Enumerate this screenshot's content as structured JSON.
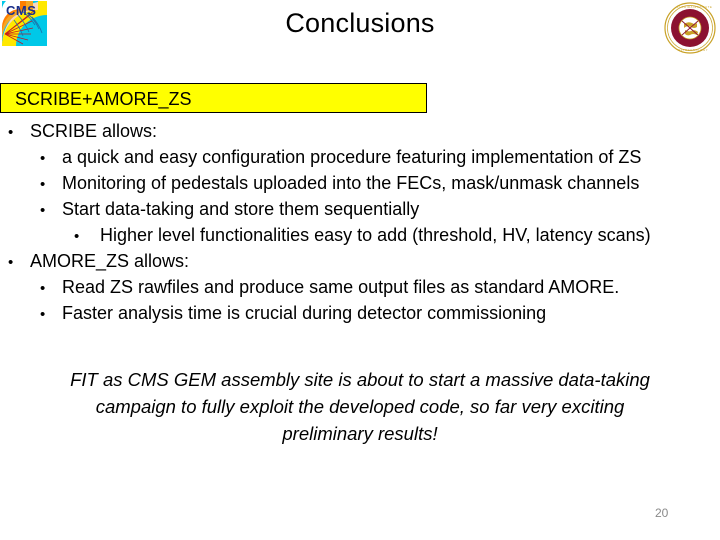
{
  "slide": {
    "title": "Conclusions",
    "page_number": "20"
  },
  "logos": {
    "left": {
      "name": "cms-experiment-logo",
      "colors": {
        "blue": "#19a9dd",
        "cyan": "#00c0e8",
        "orange": "#f5a623",
        "yellow": "#ffe800",
        "red": "#d0021b",
        "skin": "#f7d8bd",
        "text": "#1b2f8a"
      },
      "text": "CMS"
    },
    "right": {
      "name": "florida-tech-seal-logo",
      "colors": {
        "maroon": "#8c1230",
        "gold": "#c9a227",
        "white": "#ffffff"
      }
    }
  },
  "section_box": {
    "label": "SCRIBE+AMORE_ZS",
    "background": "#ffff00",
    "border": "#000000"
  },
  "bullets": [
    {
      "level": 1,
      "marker": "•",
      "text": "SCRIBE allows:"
    },
    {
      "level": 2,
      "marker": "•",
      "text": "a quick and easy configuration procedure featuring implementation of ZS"
    },
    {
      "level": 2,
      "marker": "•",
      "text": "Monitoring of pedestals uploaded into the FECs, mask/unmask channels"
    },
    {
      "level": 2,
      "marker": "•",
      "text": "Start data-taking and store them sequentially"
    },
    {
      "level": 3,
      "marker": "•",
      "text": "Higher level functionalities easy to add (threshold, HV, latency scans)"
    },
    {
      "level": 1,
      "marker": "•",
      "text": "AMORE_ZS allows:"
    },
    {
      "level": 2,
      "marker": "•",
      "text": "Read ZS rawfiles and produce same output files as standard AMORE."
    },
    {
      "level": 2,
      "marker": "•",
      "text": "Faster analysis time is crucial during detector commissioning"
    }
  ],
  "closing_note": {
    "lines": [
      "FIT as CMS GEM assembly site is about to start a massive data-taking",
      "campaign to fully exploit the developed code, so far very exciting",
      "preliminary results!"
    ]
  }
}
